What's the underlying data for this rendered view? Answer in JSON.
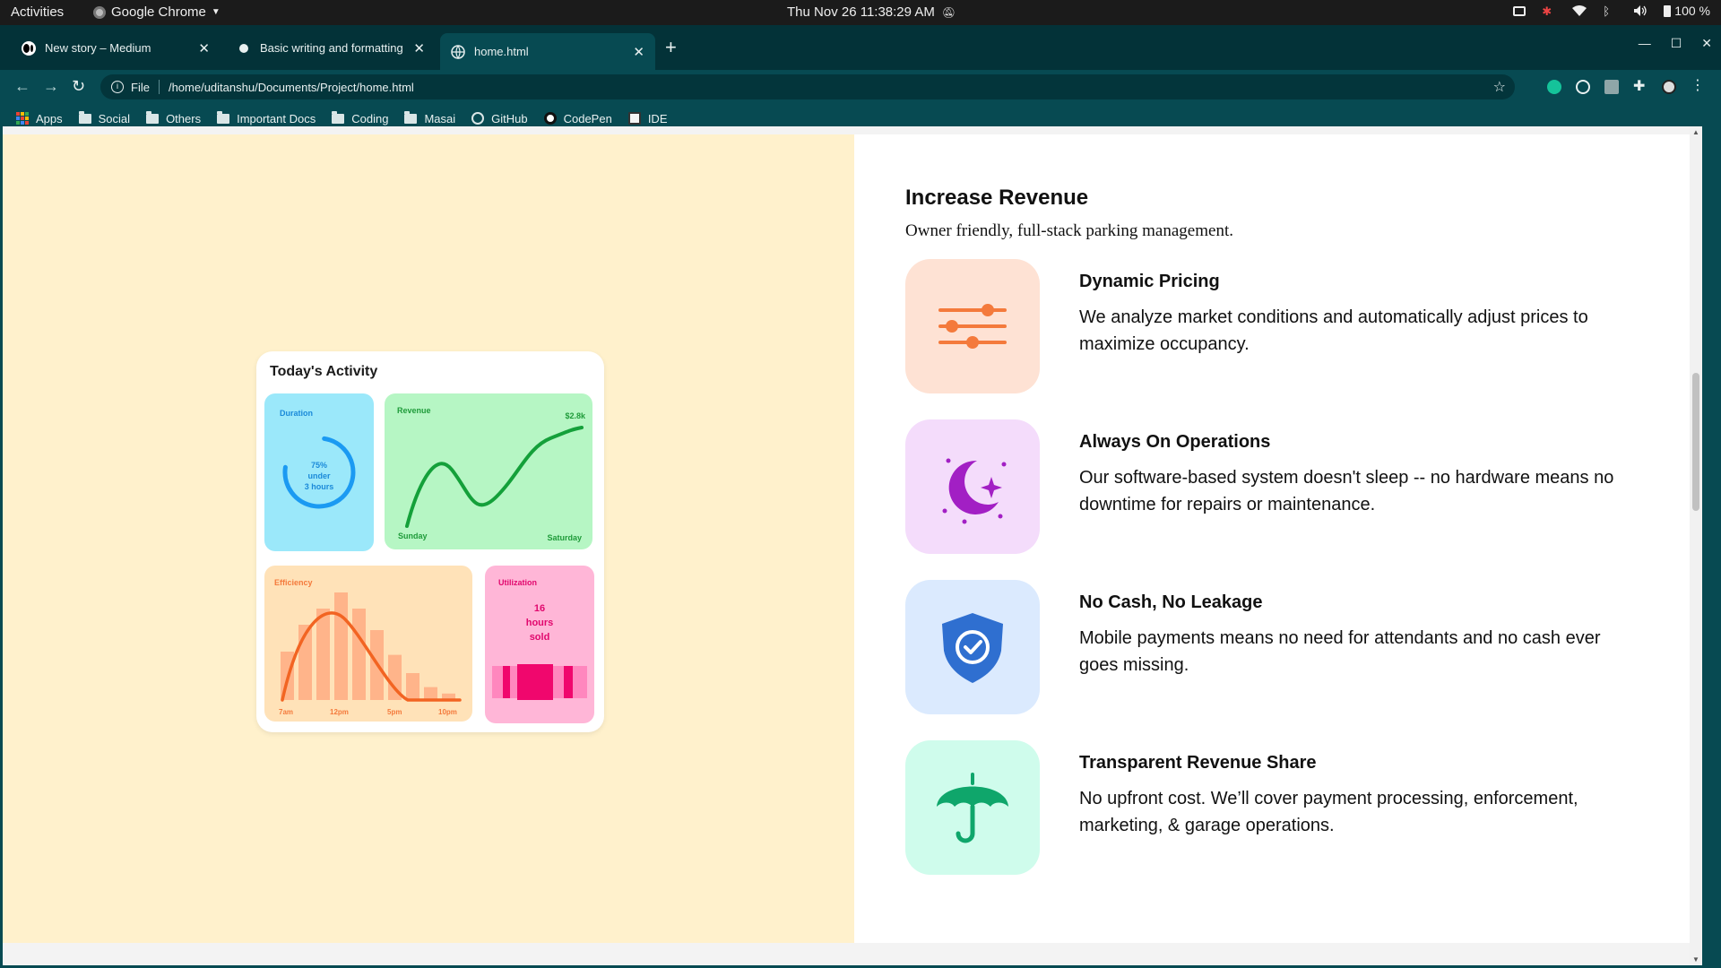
{
  "system_bar": {
    "activities": "Activities",
    "app_name": "Google Chrome",
    "clock": "Thu Nov 26  11:38:29 AM",
    "battery": "100 %"
  },
  "browser": {
    "tabs": [
      {
        "title": "New story – Medium",
        "favicon": "medium-icon"
      },
      {
        "title": "Basic writing and formatting sy",
        "favicon": "github-icon"
      },
      {
        "title": "home.html",
        "favicon": "globe-icon",
        "active": true
      }
    ],
    "url_scheme": "File",
    "url": "/home/uditanshu/Documents/Project/home.html",
    "bookmarks": [
      {
        "label": "Apps",
        "icon": "apps-grid-icon"
      },
      {
        "label": "Social",
        "icon": "folder-icon"
      },
      {
        "label": "Others",
        "icon": "folder-icon"
      },
      {
        "label": "Important Docs",
        "icon": "folder-icon"
      },
      {
        "label": "Coding",
        "icon": "folder-icon"
      },
      {
        "label": "Masai",
        "icon": "folder-icon"
      },
      {
        "label": "GitHub",
        "icon": "github-icon"
      },
      {
        "label": "CodePen",
        "icon": "codepen-icon"
      },
      {
        "label": "IDE",
        "icon": "ide-icon"
      }
    ]
  },
  "activity_card": {
    "title": "Today's Activity",
    "duration": {
      "label": "Duration",
      "line1": "75%",
      "line2": "under",
      "line3": "3 hours",
      "fraction": 0.75
    },
    "revenue": {
      "label": "Revenue",
      "amount": "$2.8k",
      "start_label": "Sunday",
      "end_label": "Saturday"
    },
    "efficiency": {
      "label": "Efficiency",
      "ticks": [
        "7am",
        "12pm",
        "5pm",
        "10pm"
      ],
      "bars": [
        0.45,
        0.7,
        0.85,
        1.0,
        0.85,
        0.65,
        0.42,
        0.25,
        0.12,
        0.06
      ]
    },
    "utilization": {
      "label": "Utilization",
      "line1": "16",
      "line2": "hours",
      "line3": "sold"
    }
  },
  "section": {
    "heading": "Increase Revenue",
    "subheading": "Owner friendly, full-stack parking management.",
    "features": [
      {
        "title": "Dynamic Pricing",
        "description": "We analyze market conditions and automatically adjust prices to maximize occupancy.",
        "icon": "sliders-icon",
        "bg": "#fee2d4",
        "color": "#f47a3c"
      },
      {
        "title": "Always On Operations",
        "description": "Our software-based system doesn't sleep -- no hardware means no downtime for repairs or maintenance.",
        "icon": "moon-stars-icon",
        "bg": "#f4dcfb",
        "color": "#a21fc4"
      },
      {
        "title": "No Cash, No Leakage",
        "description": "Mobile payments means no need for attendants and no cash ever goes missing.",
        "icon": "shield-check-icon",
        "bg": "#dbeafe",
        "color": "#2f6fd0"
      },
      {
        "title": "Transparent Revenue Share",
        "description": "No upfront cost. We’ll cover payment processing, enforcement, marketing, & garage operations.",
        "icon": "umbrella-icon",
        "bg": "#cffcec",
        "color": "#0fa66b"
      }
    ]
  }
}
